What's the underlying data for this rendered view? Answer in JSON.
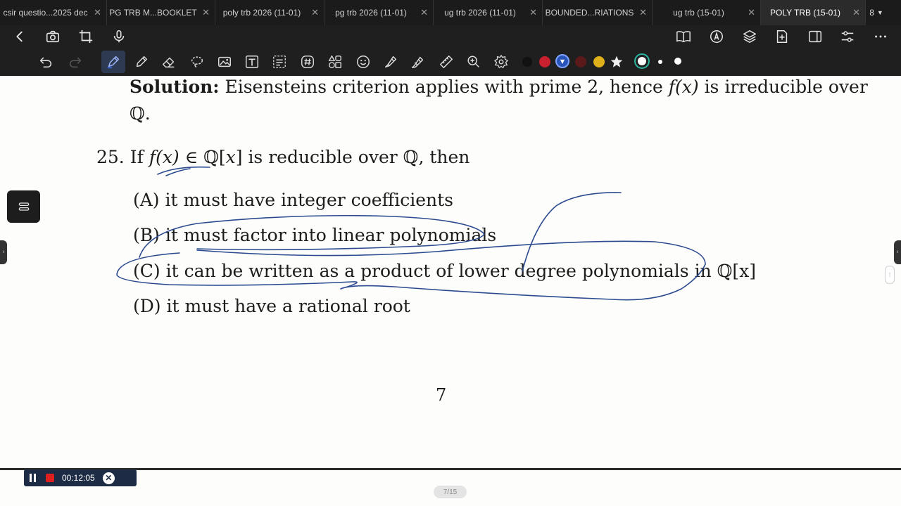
{
  "tabs": [
    {
      "label": "csir questio...2025 dec",
      "active": false
    },
    {
      "label": "PG TRB M...BOOKLET",
      "active": false
    },
    {
      "label": "poly trb 2026 (11-01)",
      "active": false
    },
    {
      "label": "pg trb 2026 (11-01)",
      "active": false
    },
    {
      "label": "ug trb 2026 (11-01)",
      "active": false
    },
    {
      "label": "BOUNDED...RIATIONS",
      "active": false
    },
    {
      "label": "ug trb (15-01)",
      "active": false
    },
    {
      "label": "POLY TRB (15-01)",
      "active": true
    }
  ],
  "tab_count": "8",
  "top_icons": {
    "left": [
      "back-arrow-icon",
      "camera-icon",
      "crop-icon",
      "microphone-icon"
    ],
    "right": [
      "book-icon",
      "pen-circle-icon",
      "layers-icon",
      "add-page-icon",
      "sidebar-icon",
      "sliders-icon",
      "more-icon"
    ]
  },
  "tools": [
    "undo-icon",
    "redo-icon",
    "pen-icon",
    "pencil-icon",
    "eraser-icon",
    "lasso-icon",
    "image-icon",
    "text-icon",
    "text-select-icon",
    "hash-icon",
    "shapes-icon",
    "emoji-icon",
    "highlighter-icon",
    "marker-icon",
    "ruler-icon",
    "zoom-icon",
    "settings-icon"
  ],
  "colors": {
    "black": "#111111",
    "red": "#c8202f",
    "blue_selected": "#2a55b8",
    "maroon": "#5a1a1a",
    "yellow": "#e0b01a",
    "ink": "#2b4a8f"
  },
  "document": {
    "solution_label": "Solution:",
    "solution_text_1": "Eisensteins criterion applies with prime 2, hence",
    "solution_fx": "f(x)",
    "solution_text_2": "is irreducible over",
    "solution_Q": "ℚ.",
    "q_number": "25.",
    "q_if": "If",
    "q_fx": "f(x)",
    "q_in": "∈ ℚ[",
    "q_x": "x",
    "q_close": "]",
    "q_rest": "is reducible over ℚ, then",
    "options": [
      {
        "key": "(A)",
        "text": "it must have integer coefficients"
      },
      {
        "key": "(B)",
        "text": "it must factor into linear polynomials"
      },
      {
        "key": "(C)",
        "text": "it can be written as a product of lower degree polynomials in ℚ[x]"
      },
      {
        "key": "(D)",
        "text": "it must have a rational root"
      }
    ],
    "page_number": "7"
  },
  "recording": {
    "time": "00:12:05"
  },
  "page_indicator": "7/15"
}
